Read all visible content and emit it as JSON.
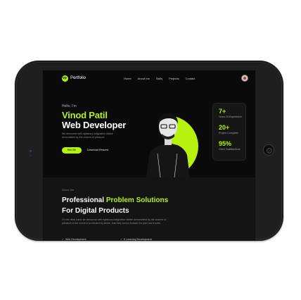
{
  "nav": {
    "brand": "Portfolio",
    "logo_mark": "vp",
    "links": [
      "Home",
      "About me",
      "Skills",
      "Projects",
      "Contact"
    ]
  },
  "hero": {
    "greeting": "Hello, I'm",
    "name": "Vinod Patil",
    "role": "Web Developer",
    "description": "We denounce with righteous indignation dislike demoralized by the charms of pleasure.",
    "hire_button": "Hire Me",
    "resume_button": "Download Resume"
  },
  "stats": [
    {
      "value": "7+",
      "label": "Years Of Experience"
    },
    {
      "value": "20+",
      "label": "Project Complete"
    },
    {
      "value": "95%",
      "label": "Client Satisfactions"
    }
  ],
  "about": {
    "label": "About Me",
    "heading_part1": "Professional ",
    "heading_accent": "Problem Solutions",
    "heading_line2": "For Digital Products",
    "paragraph": "On the other hand we denounce with righteous indignation dislike demoralized by the charms of pleasure of the moment so blinded by desire, that they cannot foresee the pain and trouble.",
    "skills": [
      "Web Development",
      "E-Learning Development"
    ]
  },
  "colors": {
    "accent": "#b7f20f",
    "background": "#0a0a0a",
    "device": "#1f1f20"
  }
}
